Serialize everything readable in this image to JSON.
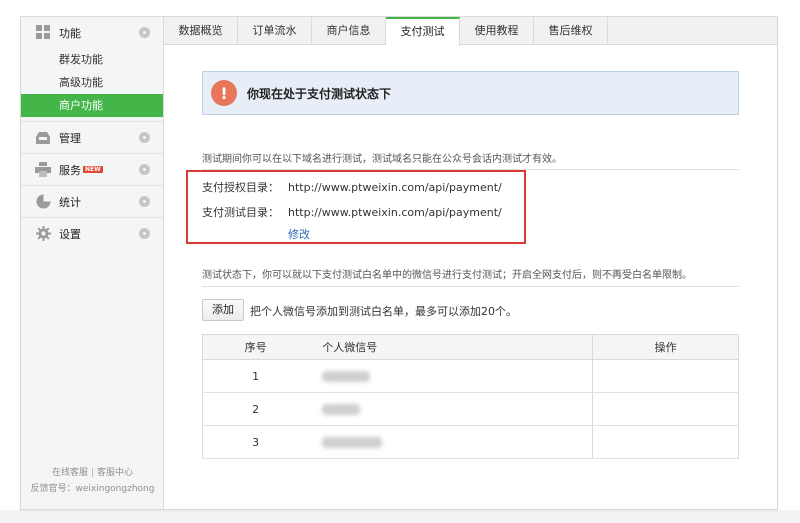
{
  "sidebar": {
    "groups": [
      {
        "label": "功能",
        "icon": "grid-icon"
      },
      {
        "label": "管理",
        "icon": "inbox-icon"
      },
      {
        "label": "服务",
        "icon": "printer-icon",
        "badge": "NEW"
      },
      {
        "label": "统计",
        "icon": "pie-chart-icon"
      },
      {
        "label": "设置",
        "icon": "gear-icon"
      }
    ],
    "subitems": [
      "群发功能",
      "高级功能",
      "商户功能"
    ],
    "footer": {
      "online_service": "在线客服",
      "help_center": "客服中心",
      "feedback": "反馈官号：weixingongzhong"
    }
  },
  "tabs": [
    "数据概览",
    "订单流水",
    "商户信息",
    "支付测试",
    "使用教程",
    "售后维权"
  ],
  "active_tab": "支付测试",
  "main": {
    "alert": "你现在处于支付测试状态下",
    "description": "测试期间你可以在以下域名进行测试，测试域名只能在公众号会话内测试才有效。",
    "auth_dir_label": "支付授权目录：",
    "auth_dir_value": "http://www.ptweixin.com/api/payment/",
    "test_dir_label": "支付测试目录：",
    "test_dir_value": "http://www.ptweixin.com/api/payment/",
    "edit_link": "修改",
    "whitelist_desc": "测试状态下，你可以就以下支付测试白名单中的微信号进行支付测试；开启全网支付后，则不再受白名单限制。",
    "add_button": "添加",
    "add_tip": "把个人微信号添加到测试白名单，最多可以添加20个。",
    "table": {
      "headers": [
        "序号",
        "个人微信号",
        "操作"
      ],
      "rows": [
        {
          "index": "1"
        },
        {
          "index": "2"
        },
        {
          "index": "3"
        }
      ]
    }
  },
  "colors": {
    "accent_green": "#44b549",
    "highlight_red": "#d63a33",
    "link_blue": "#2b6db5",
    "alert_bg": "#e8eef8",
    "warning_icon": "#e8765b"
  }
}
